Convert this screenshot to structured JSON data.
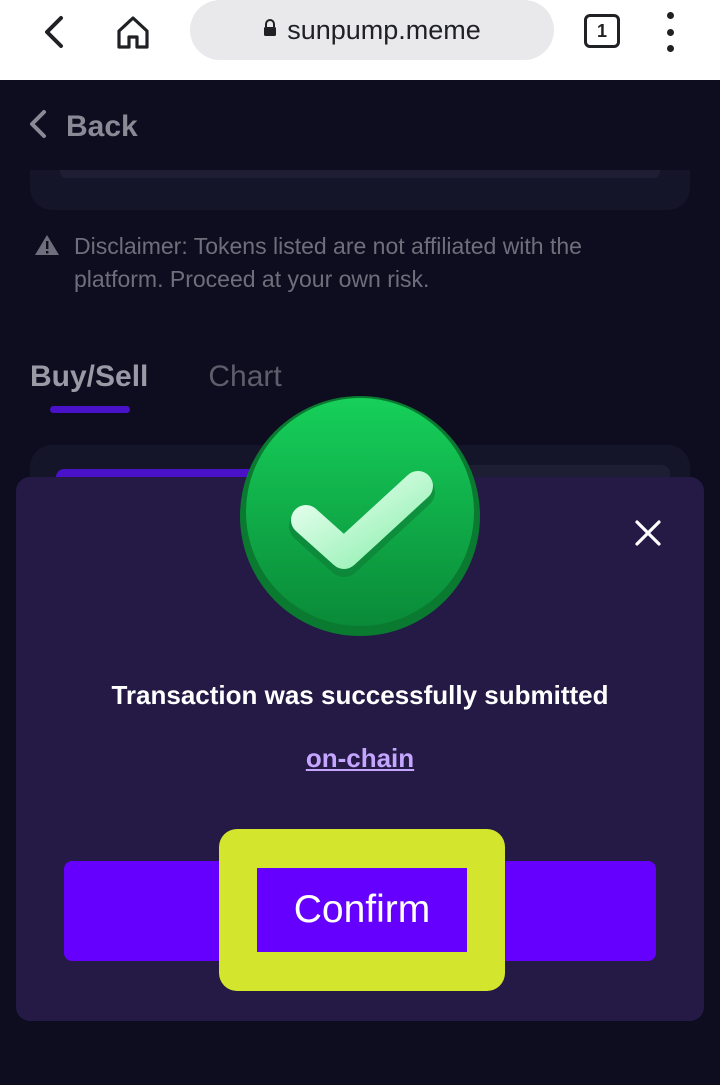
{
  "browser": {
    "url": "sunpump.meme",
    "tab_count": "1"
  },
  "page": {
    "back_label": "Back",
    "disclaimer": "Disclaimer: Tokens listed are not affiliated with the platform. Proceed at your own risk.",
    "tabs": [
      {
        "label": "Buy/Sell",
        "active": true
      },
      {
        "label": "Chart",
        "active": false
      }
    ]
  },
  "modal": {
    "title": "Transaction was successfully submitted",
    "link_label": "on-chain",
    "confirm_label": "Confirm"
  },
  "colors": {
    "modal_bg": "#241a45",
    "accent": "#6500ff",
    "highlight": "#d3e52c",
    "success": "#10b848"
  },
  "icons": [
    "back-arrow-icon",
    "home-icon",
    "lock-icon",
    "more-vert-icon",
    "chevron-left-icon",
    "warning-icon",
    "close-icon",
    "success-check-icon"
  ]
}
